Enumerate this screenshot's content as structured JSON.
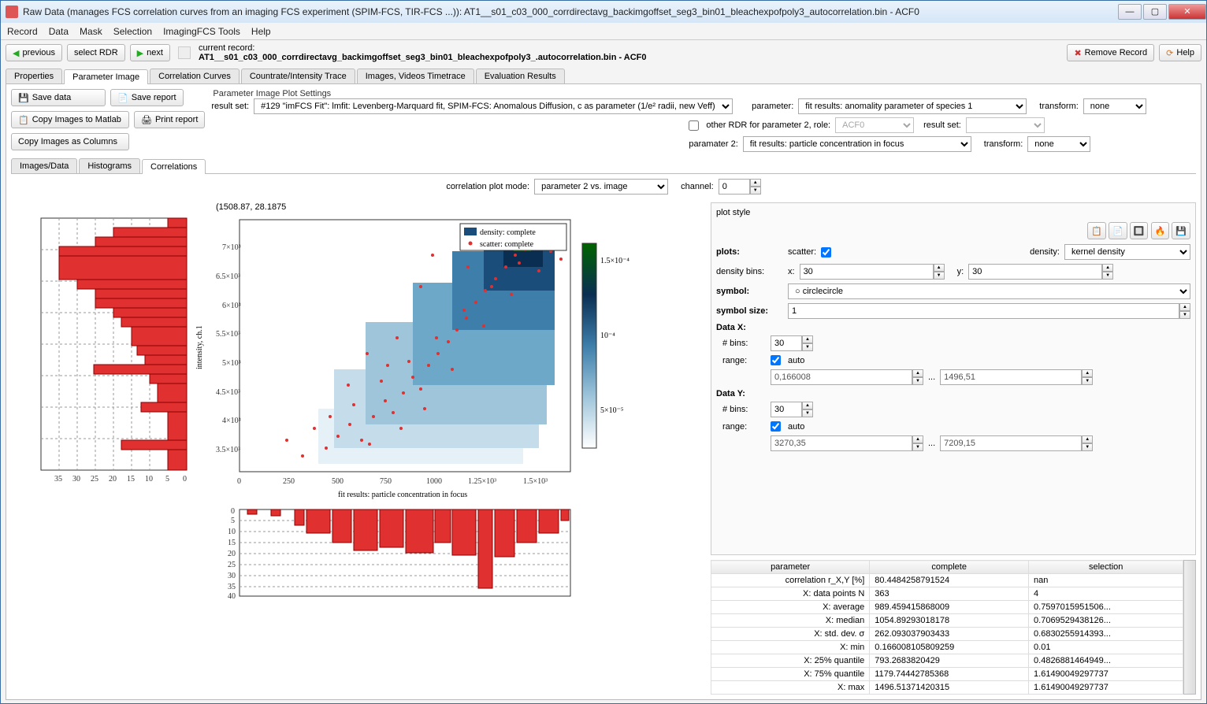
{
  "title": "Raw Data (manages FCS correlation curves from an imaging FCS experiment (SPIM-FCS, TIR-FCS ...)): AT1__s01_c03_000_corrdirectavg_backimgoffset_seg3_bin01_bleachexpofpoly3_autocorrelation.bin - ACF0",
  "menu": [
    "Record",
    "Data",
    "Mask",
    "Selection",
    "ImagingFCS Tools",
    "Help"
  ],
  "nav": {
    "previous": "previous",
    "selectRDR": "select RDR",
    "next": "next"
  },
  "record": {
    "label": "current record:",
    "name": "AT1__s01_c03_000_corrdirectavg_backimgoffset_seg3_bin01_bleachexpofpoly3_.autocorrelation.bin - ACF0"
  },
  "removeRecord": "Remove Record",
  "help": "Help",
  "mainTabs": [
    "Properties",
    "Parameter Image",
    "Correlation Curves",
    "Countrate/Intensity Trace",
    "Images, Videos  Timetrace",
    "Evaluation Results"
  ],
  "activeMainTab": 1,
  "saveData": "Save data",
  "saveReport": "Save report",
  "copyMatlab": "Copy Images to Matlab",
  "printReport": "Print report",
  "copyColumns": "Copy Images as Columns",
  "settingsTitle": "Parameter Image Plot Settings",
  "resultSetLabel": "result set:",
  "resultSet": "#129 \"imFCS Fit\": lmfit: Levenberg-Marquard fit, SPIM-FCS: Anomalous Diffusion, c as parameter (1/e² radii, new Veff)",
  "paramLabel": "parameter:",
  "param": "fit results: anomality parameter of species 1",
  "transformLabel": "transform:",
  "transform1": "none",
  "transform2": "none",
  "otherRDRLabel": "other RDR for parameter 2, role:",
  "otherRDRVal": "ACF0",
  "resultSet2Label": "result set:",
  "param2Label": "paramater 2:",
  "param2": "fit results: particle concentration in focus",
  "subTabs": [
    "Images/Data",
    "Histograms",
    "Correlations"
  ],
  "activeSubTab": 2,
  "corrModeLabel": "correlation plot mode:",
  "corrMode": "parameter 2 vs. image",
  "channelLabel": "channel:",
  "channel": "0",
  "coords": "(1508.87, 28.1875",
  "legend": {
    "density": "density: complete",
    "scatter": "scatter: complete"
  },
  "ylabel": "intensity, ch.1",
  "xlabel": "fit results: particle concentration in focus",
  "plotStyleTitle": "plot style",
  "ps": {
    "plots": "plots:",
    "scatter": "scatter:",
    "density": "density:",
    "densityMode": "kernel density",
    "densityBins": "density bins:",
    "x_lbl": "x:",
    "x": "30",
    "y_lbl": "y:",
    "y": "30",
    "symbol": "symbol:",
    "symbolVal": "circle",
    "symbolSize": "symbol size:",
    "symbolSizeVal": "1",
    "dataX": "Data X:",
    "dataY": "Data Y:",
    "nbins": "# bins:",
    "nbinsX": "30",
    "nbinsY": "30",
    "range": "range:",
    "auto": "auto",
    "xmin": "0,166008",
    "xmax": "1496,51",
    "ymin": "3270,35",
    "ymax": "7209,15",
    "ellipsis": "..."
  },
  "stats": {
    "headers": [
      "parameter",
      "complete",
      "selection"
    ],
    "rows": [
      [
        "correlation r_X,Y [%]",
        "80.4484258791524",
        "nan"
      ],
      [
        "X: data points N",
        "363",
        "4"
      ],
      [
        "X: average",
        "989.459415868009",
        "0.7597015951506..."
      ],
      [
        "X: median",
        "1054.89293018178",
        "0.7069529438126..."
      ],
      [
        "X: std. dev. σ",
        "262.093037903433",
        "0.6830255914393..."
      ],
      [
        "X: min",
        "0.166008105809259",
        "0.01"
      ],
      [
        "X: 25% quantile",
        "793.2683820429",
        "0.4826881464949..."
      ],
      [
        "X: 75% quantile",
        "1179.74442785368",
        "1.61490049297737"
      ],
      [
        "X: max",
        "1496.51371420315",
        "1.61490049297737"
      ]
    ]
  },
  "chart_data": {
    "type": "scatter",
    "xlabel": "fit results: particle concentration in focus",
    "ylabel": "intensity, ch.1",
    "xlim": [
      0,
      1500
    ],
    "ylim": [
      3200,
      7500
    ],
    "xticks": [
      0,
      250,
      500,
      750,
      1000,
      "1.25×10³",
      "1.5×10³"
    ],
    "yticks": [
      "3.5×10³",
      "4×10³",
      "4.5×10³",
      "5×10³",
      "5.5×10³",
      "6×10³",
      "6.5×10³",
      "7×10³"
    ],
    "colorbar": {
      "ticks": [
        "1.5×10⁻⁴",
        "10⁻⁴",
        "5×10⁻⁵"
      ],
      "range": [
        1e-05,
        0.0002
      ]
    },
    "series": [
      {
        "name": "density: complete",
        "type": "heatmap"
      },
      {
        "name": "scatter: complete",
        "type": "scatter",
        "points_count": 363
      }
    ],
    "side_hist_y": {
      "axis": "y",
      "xticks": [
        0,
        5,
        10,
        15,
        20,
        25,
        30,
        35
      ],
      "orientation": "horizontal",
      "max": 35
    },
    "side_hist_x": {
      "axis": "x",
      "yticks": [
        0,
        5,
        10,
        15,
        20,
        25,
        30,
        35,
        40
      ],
      "orientation": "vertical",
      "max": 40
    }
  }
}
